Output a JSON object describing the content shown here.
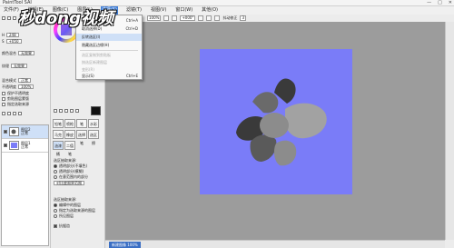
{
  "app": {
    "title": "PaintTool SAI"
  },
  "window_controls": {
    "minimize": "—",
    "maximize": "□",
    "close": "✕"
  },
  "watermark": {
    "text": "秒dong视频"
  },
  "menubar": {
    "items": [
      {
        "label": "文件(F)"
      },
      {
        "label": "编辑(E)"
      },
      {
        "label": "图像(C)"
      },
      {
        "label": "图层(L)"
      },
      {
        "label": "选择(S)",
        "active": true
      },
      {
        "label": "滤镜(T)"
      },
      {
        "label": "视图(V)"
      },
      {
        "label": "窗口(W)"
      },
      {
        "label": "其他(O)"
      }
    ]
  },
  "toolbar": {
    "zoom_value": "100%",
    "angle_value": "+000°",
    "stabilizer_label": "抖动修正",
    "stabilizer_value": "3"
  },
  "dropdown": {
    "items": [
      {
        "label": "全部选择(A)",
        "shortcut": "Ctrl+A"
      },
      {
        "label": "取消选择(D)",
        "shortcut": "Ctrl+D"
      },
      {
        "label": "反转选区(I)",
        "shortcut": "",
        "highlight": true
      },
      {
        "label": "隐藏选区边缘(H)",
        "shortcut": ""
      },
      {
        "label": "选区复制到剪贴板",
        "shortcut": "",
        "disabled": true
      },
      {
        "label": "按选区新建图层",
        "shortcut": "",
        "disabled": true
      },
      {
        "label": "变形(R)",
        "shortcut": "",
        "disabled": true
      },
      {
        "label": "显示(S)",
        "shortcut": "Ctrl+E"
      }
    ]
  },
  "left_panel": {
    "layer_mode_label": "混合模式",
    "layer_mode_value": "正常",
    "opacity_label": "不透明度",
    "opacity_value": "100%",
    "checks": [
      {
        "label": "保护不透明度",
        "on": false
      },
      {
        "label": "剪贴图层蒙版",
        "on": false
      },
      {
        "label": "指定选取来源",
        "on": false
      }
    ],
    "layers": [
      {
        "name": "图层2",
        "mode": "正常",
        "opacity": "100%"
      },
      {
        "name": "图层1",
        "mode": "正常",
        "opacity": "100%"
      }
    ],
    "hsv_h_label": "H",
    "hsv_h": "248",
    "hsv_s_label": "S",
    "hsv_s": "+050",
    "mix_label": "颜色混合",
    "mix_value": "无效果",
    "tex_label": "纹理",
    "tex_value": "无效果"
  },
  "tool_panel": {
    "brush_names": [
      "铅笔",
      "喷枪",
      "笔",
      "水彩笔",
      "马克笔",
      "橡皮擦",
      "选择笔",
      "选区擦",
      "油漆桶",
      "二值笔"
    ],
    "fill_mode_label": "选区抽取来源:",
    "fill_options": [
      {
        "label": "透明部分(不填色)",
        "on": true
      },
      {
        "label": "透明部分(模糊)",
        "on": false
      },
      {
        "label": "在意范围内的部分",
        "on": false
      }
    ],
    "fill_range_label": "对比度限界范围",
    "fill_target_label": "选区抽取来源:",
    "target_options": [
      {
        "label": "编辑中的图层",
        "on": true
      },
      {
        "label": "指定为选取来源的图层",
        "on": false
      },
      {
        "label": "所见图层",
        "on": false
      }
    ],
    "antialias_label": "抗锯齿"
  },
  "document": {
    "tab_label": "新建图像",
    "zoom": "100%"
  },
  "colors": {
    "accent": "#3b7bd6",
    "canvas_bg": "#9c9c9c",
    "paper": "#7a7cf8",
    "flower_dark": "#3a3a3a",
    "flower_mid": "#6a6a6a",
    "flower_light": "#a2a2a2",
    "flower_center": "#8c8c8c"
  }
}
